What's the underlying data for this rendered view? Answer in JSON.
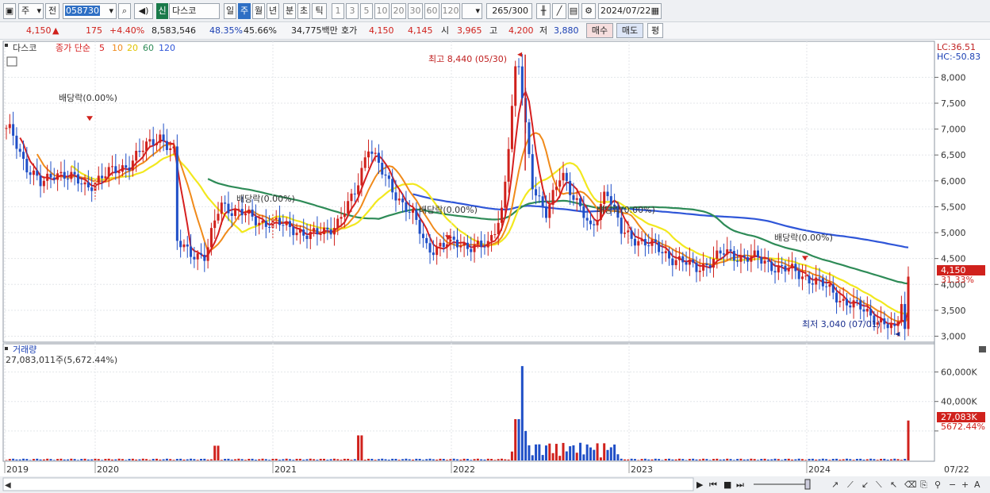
{
  "toolbar": {
    "period_select": "주",
    "prev_label": "전",
    "code": "058730",
    "name_tag": "신",
    "name": "다스코",
    "period_tabs": [
      "일",
      "주",
      "월",
      "년",
      "분",
      "초",
      "틱"
    ],
    "active_tab": "주",
    "number_tabs": [
      "1",
      "3",
      "5",
      "10",
      "20",
      "30",
      "60",
      "120"
    ],
    "count": "265",
    "count_total": "/300",
    "date": "2024/07/22"
  },
  "quote": {
    "price": "4,150",
    "change": "175",
    "change_pct": "+4.40%",
    "volume": "8,583,546",
    "vol_ratio": "48.35%",
    "turnover": "45.66%",
    "amount": "34,775백만",
    "ask_label": "호가",
    "ask1": "4,150",
    "ask2": "4,145",
    "open_label": "시",
    "open": "3,965",
    "high_label": "고",
    "high": "4,200",
    "low_label": "저",
    "low": "3,880",
    "buy_label": "매수",
    "sell_label": "매도",
    "avg_label": "평"
  },
  "legend": {
    "name": "다스코",
    "ma_label": "종가 단순",
    "ma_periods": [
      "5",
      "10",
      "20",
      "60",
      "120"
    ]
  },
  "annotations": {
    "high": "최고 8,440 (05/30)",
    "low": "최저 3,040 (07/01)",
    "dividend": "배당락(0.00%)",
    "lc": "LC:36.51",
    "hc": "HC:-50.83",
    "last_price": "4,150",
    "last_pct": "31.33%"
  },
  "volume_panel": {
    "title": "거래량",
    "summary": "27,083,011주(5,672.44%)",
    "last": "27,083K",
    "last_pct": "5672.44%"
  },
  "colors": {
    "up": "#d0211c",
    "down": "#1f4fc7",
    "ma5": "#d62020",
    "ma10": "#f08a1a",
    "ma20": "#f2e81e",
    "ma60": "#2e8b57",
    "ma120": "#2f56d8"
  },
  "chart_data": {
    "type": "candlestick",
    "interval": "weekly",
    "price_axis": {
      "ylim": [
        2900,
        8650
      ],
      "ticks": [
        3000,
        3500,
        4000,
        4500,
        5000,
        5500,
        6000,
        6500,
        7000,
        7500,
        8000
      ]
    },
    "volume_axis": {
      "ylim": [
        0,
        70000
      ],
      "ticks": [
        20000,
        40000,
        60000
      ],
      "tick_labels": [
        "",
        "40,000K",
        "60,000K"
      ],
      "unit": "K"
    },
    "x_labels": [
      "2019",
      "2020",
      "2021",
      "2022",
      "2023",
      "2024",
      "07/22"
    ],
    "close_path": [
      [
        "2019-01",
        6950
      ],
      [
        "2019-02",
        6300
      ],
      [
        "2019-03",
        5900
      ],
      [
        "2019-04",
        6200
      ],
      [
        "2019-06",
        5900
      ],
      [
        "2019-09",
        6350
      ],
      [
        "2019-11",
        6900
      ],
      [
        "2019-12",
        6500
      ],
      [
        "2020-02",
        5800
      ],
      [
        "2020-03",
        4300
      ],
      [
        "2020-04",
        5000
      ],
      [
        "2020-05",
        5300
      ],
      [
        "2020-06",
        4800
      ],
      [
        "2020-08",
        4500
      ],
      [
        "2020-09",
        5600
      ],
      [
        "2020-10",
        5400
      ],
      [
        "2020-12",
        5200
      ],
      [
        "2021-02",
        5100
      ],
      [
        "2021-03",
        4900
      ],
      [
        "2021-05",
        5200
      ],
      [
        "2021-06",
        5700
      ],
      [
        "2021-07",
        6700
      ],
      [
        "2021-08",
        6100
      ],
      [
        "2021-10",
        5300
      ],
      [
        "2021-11",
        4700
      ],
      [
        "2022-01",
        4800
      ],
      [
        "2022-03",
        4700
      ],
      [
        "2022-04",
        5500
      ],
      [
        "2022-05",
        8440
      ],
      [
        "2022-06",
        6000
      ],
      [
        "2022-07",
        5300
      ],
      [
        "2022-08",
        6200
      ],
      [
        "2022-10",
        5000
      ],
      [
        "2022-11",
        5900
      ],
      [
        "2022-12",
        5000
      ],
      [
        "2023-01",
        4900
      ],
      [
        "2023-03",
        4600
      ],
      [
        "2023-05",
        4300
      ],
      [
        "2023-07",
        4600
      ],
      [
        "2023-09",
        4500
      ],
      [
        "2023-11",
        4300
      ],
      [
        "2024-01",
        4100
      ],
      [
        "2024-03",
        3700
      ],
      [
        "2024-05",
        3400
      ],
      [
        "2024-06",
        3200
      ],
      [
        "2024-07-01",
        3040
      ],
      [
        "2024-07-22",
        4150
      ]
    ],
    "high": {
      "value": 8440,
      "date": "05/30"
    },
    "low": {
      "value": 3040,
      "date": "07/01"
    },
    "last": {
      "close": 4150,
      "volume_k": 27083
    }
  }
}
